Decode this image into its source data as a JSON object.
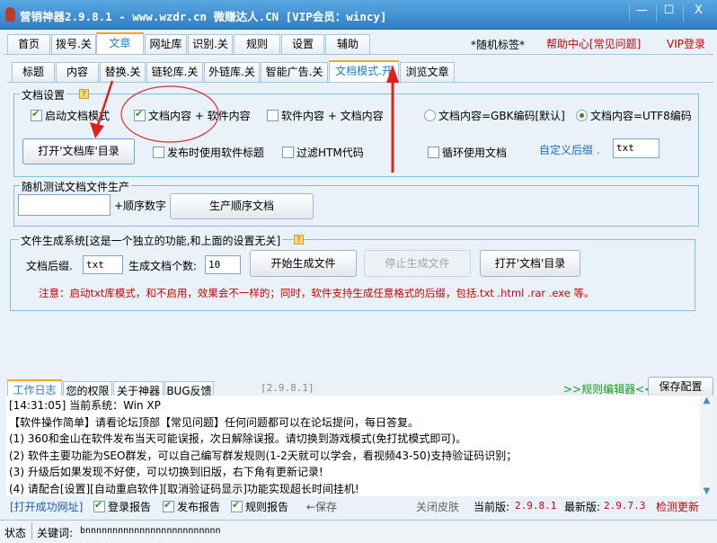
{
  "window": {
    "title": "营销神器2.9.8.1 - www.wzdr.cn 微赚达人.CN [VIP会员：wincy]",
    "minimize": "—",
    "maximize": "☐",
    "close": "X"
  },
  "main_tabs": [
    "首页",
    "拨号.关",
    "文章",
    "网址库",
    "识别.关",
    "规则",
    "设置",
    "辅助"
  ],
  "top_links": {
    "random_tag": "*随机标签*",
    "help": "帮助中心[常见问题]",
    "vip_login": "VIP登录"
  },
  "sub_tabs": [
    "标题",
    "内容",
    "替换.关",
    "链轮库.关",
    "外链库.关",
    "智能广告.关",
    "文档模式.开",
    "浏览文章"
  ],
  "doc_settings": {
    "legend": "文档设置",
    "enable_doc_mode": "启动文档模式",
    "doc_plus_soft": "文档内容 + 软件内容",
    "soft_plus_doc": "软件内容 + 文档内容",
    "gbk": "文档内容=GBK编码[默认]",
    "utf8": "文档内容=UTF8编码",
    "open_doc_lib": "打开'文档库'目录",
    "use_soft_title": "发布时使用软件标题",
    "filter_htm": "过滤HTM代码",
    "loop_docs": "循环使用文档",
    "custom_suffix_label": "自定义后缀 .",
    "custom_suffix": "txt",
    "checks": {
      "enable_doc_mode": true,
      "doc_plus_soft": true,
      "soft_plus_doc": false,
      "use_soft_title": false,
      "filter_htm": false,
      "loop_docs": false
    },
    "encoding_selected": "utf8"
  },
  "random_test": {
    "legend": "随机测试文档文件生产",
    "input": "",
    "seq_label": "+顺序数字",
    "generate": "生产顺序文档"
  },
  "file_gen": {
    "legend": "文件生成系统[这是一个独立的功能,和上面的设置无关]",
    "suffix_label": "文档后缀.",
    "suffix": "txt",
    "count_label": "生成文档个数:",
    "count": "10",
    "start": "开始生成文件",
    "stop": "停止生成文件",
    "open_dir": "打开'文档'目录",
    "notice": "注意：启动txt库模式，和不启用，效果会不一样的；同时，软件支持生成任意格式的后缀，包括.txt .html .rar .exe 等。"
  },
  "bottom_tabs": [
    "工作日志",
    "您的权限",
    "关于神器",
    "BUG反馈"
  ],
  "version_tag": "[2.9.8.1]",
  "rule_editor": ">>规则编辑器<<",
  "save_config": "保存配置",
  "log_lines": [
    "[14:31:05] 当前系统：Win XP",
    "【软件操作简单】请看论坛顶部【常见问题】任何问题都可以在论坛提问，每日答复。",
    "(1) 360和金山在软件发布当天可能误报，次日解除误报。请切换到游戏模式(免打扰模式即可)。",
    "(2) 软件主要功能为SEO群发，可以自己编写群发规则(1-2天就可以学会，看视频43-50)支持验证码识别；",
    "(3) 升级后如果发现不好使，可以切换到旧版，右下角有更新记录!",
    "(4) 请配合[设置][自动重启软件][取消验证码显示]功能实现超长时间挂机!"
  ],
  "footer": {
    "open_success": "[打开成功网址]",
    "login_report": "登录报告",
    "publish_report": "发布报告",
    "rule_report": "规则报告",
    "save": "←保存",
    "close_skin": "关闭皮肤",
    "current_label": "当前版:",
    "current": "2.9.8.1",
    "latest_label": "最新版:",
    "latest": "2.9.7.3",
    "check_update": "检测更新"
  },
  "status": {
    "label": "状态",
    "keyword_label": "关键词:",
    "keyword": "bnnnnnnnnnnnnnnnnnnnnnnnnn"
  }
}
